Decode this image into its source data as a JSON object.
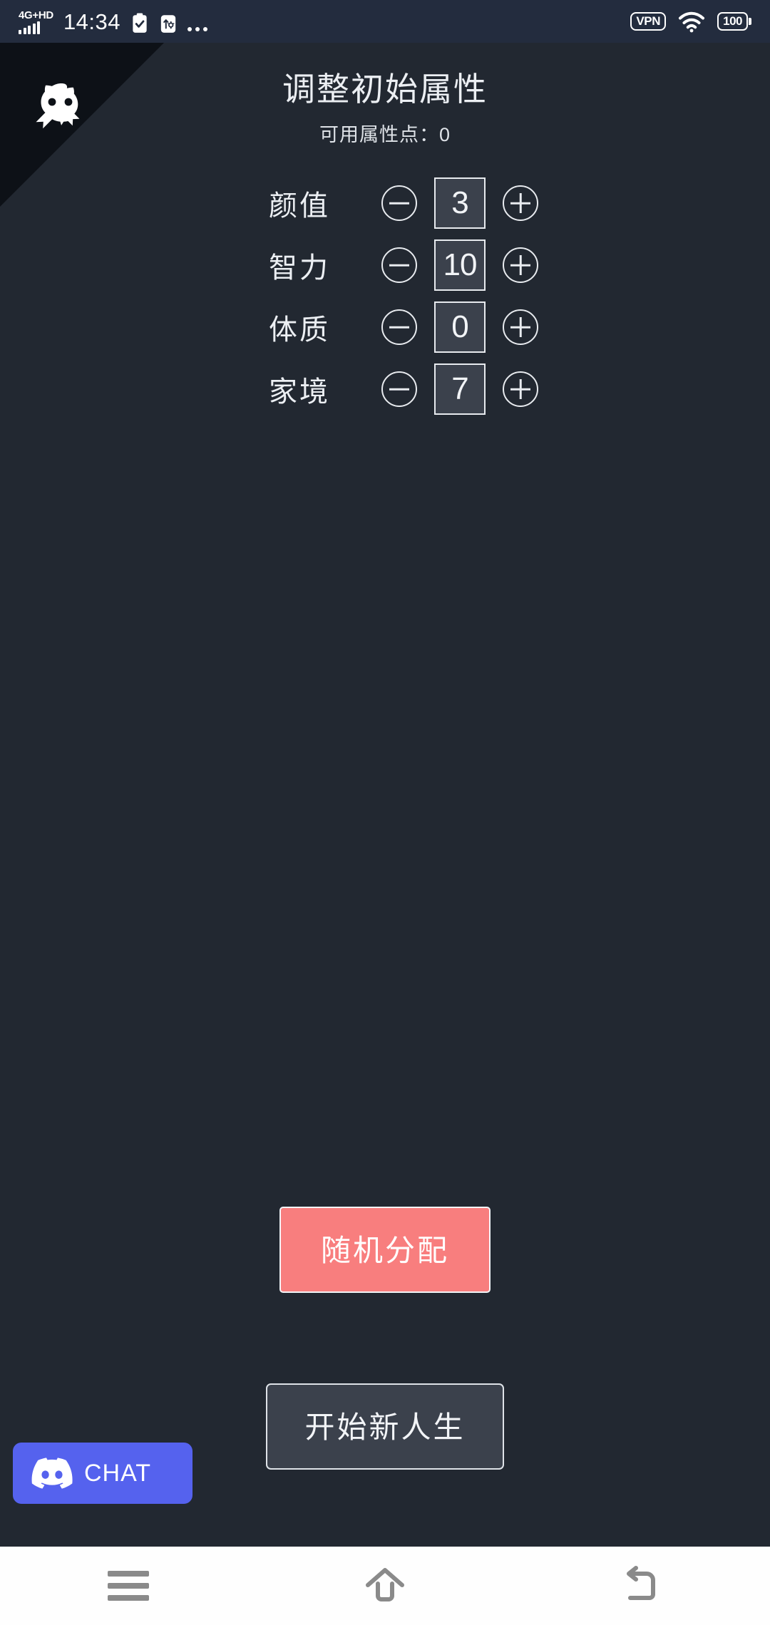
{
  "status_bar": {
    "network_label": "4G+HD",
    "time": "14:34",
    "clipboard_icon": "clipboard-check-icon",
    "usb_icon": "usb-settings-icon",
    "overflow_icon": "more-dots-icon",
    "vpn_label": "VPN",
    "wifi_icon": "wifi-icon",
    "battery_level": "100",
    "background_color": "#232c3e"
  },
  "corner_ribbon": {
    "icon": "github-octocat-icon",
    "ribbon_color": "#0d1117"
  },
  "header": {
    "title": "调整初始属性",
    "points_line": "可用属性点：0",
    "available_points": "0"
  },
  "attributes": {
    "decrement_icon": "minus-circle-icon",
    "increment_icon": "plus-circle-icon",
    "rows": [
      {
        "label": "颜值",
        "value": "3"
      },
      {
        "label": "智力",
        "value": "10"
      },
      {
        "label": "体质",
        "value": "0"
      },
      {
        "label": "家境",
        "value": "7"
      }
    ]
  },
  "actions": {
    "random_label": "随机分配",
    "random_color": "#f87e7e",
    "start_label": "开始新人生",
    "start_color": "#3b414c"
  },
  "discord_widget": {
    "label": "CHAT",
    "icon": "discord-logo-icon",
    "color": "#5562ee"
  },
  "nav_bar": {
    "menu_icon": "menu-icon",
    "home_icon": "home-icon",
    "back_icon": "back-icon",
    "background_color": "#fefefe"
  },
  "theme": {
    "background": "#222831",
    "foreground": "#eceff3",
    "value_box_fill": "#3b414c"
  }
}
